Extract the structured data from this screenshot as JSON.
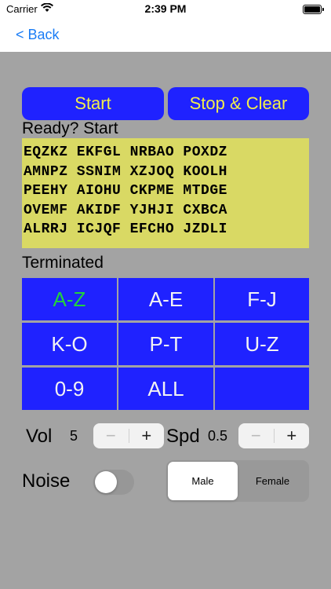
{
  "status": {
    "carrier": "Carrier",
    "time": "2:39 PM"
  },
  "nav": {
    "back_label": "< Back"
  },
  "buttons": {
    "start": "Start",
    "stop_clear": "Stop & Clear"
  },
  "status_text": "Ready? Start",
  "letter_rows": [
    "EQZKZ EKFGL NRBAO POXDZ",
    "AMNPZ SSNIM XZJOQ KOOLH",
    "PEEHY AIOHU CKPME MTDGE",
    "OVEMF AKIDF YJHJI CXBCA",
    "ALRRJ ICJQF EFCHO JZDLI"
  ],
  "terminated_label": "Terminated",
  "groups": [
    "A-Z",
    "A-E",
    "F-J",
    "K-O",
    "P-T",
    "U-Z",
    "0-9",
    "ALL",
    ""
  ],
  "active_group": "A-Z",
  "volume": {
    "label": "Vol",
    "value": "5"
  },
  "speed": {
    "label": "Spd",
    "value": "0.5"
  },
  "stepper": {
    "minus": "−",
    "plus": "+"
  },
  "noise": {
    "label": "Noise",
    "on": false
  },
  "voice": {
    "options": [
      "Male",
      "Female"
    ],
    "selected": "Male"
  },
  "colors": {
    "button_blue": "#1f22ff",
    "button_text": "#f2ee4a",
    "letters_bg": "#d9d964",
    "active_green": "#22d33b",
    "content_bg": "#a3a3a3",
    "link_blue": "#1a7cf5"
  }
}
